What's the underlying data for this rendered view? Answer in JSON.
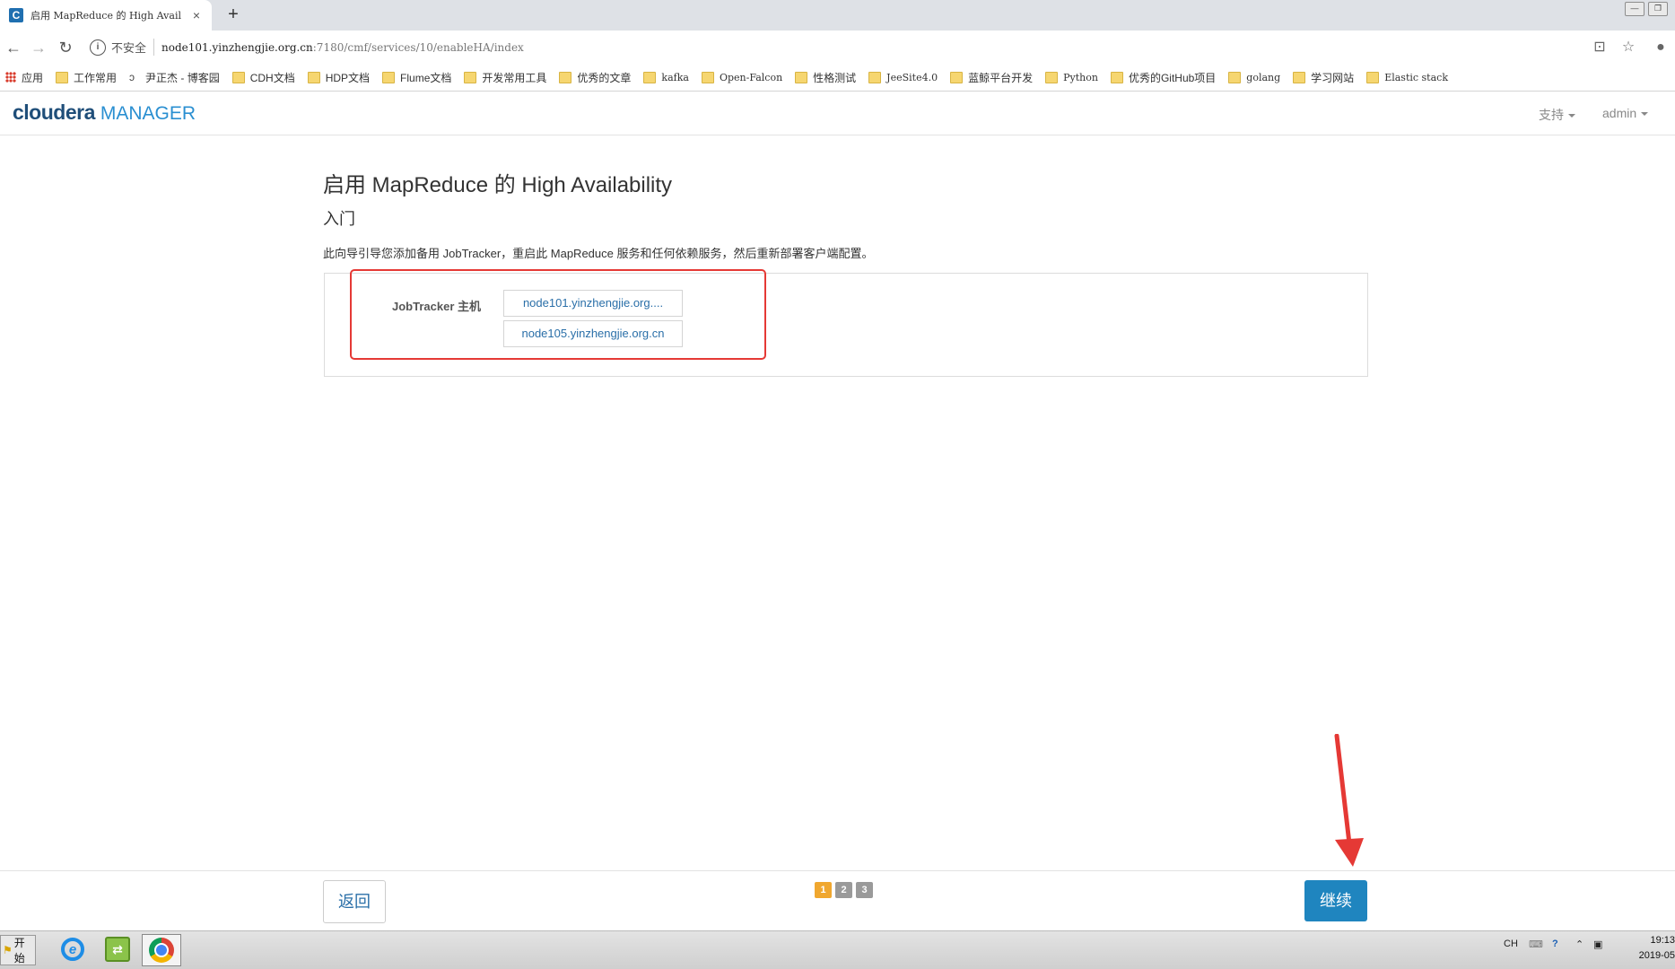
{
  "browser": {
    "tab_title": "启用 MapReduce 的 High Avail",
    "tab_close": "×",
    "favicon_letter": "C",
    "new_tab": "+",
    "security_label": "不安全",
    "url_host": "node101.yinzhengjie.org.cn",
    "url_path": ":7180/cmf/services/10/enableHA/index"
  },
  "bookmarks": [
    {
      "label": "应用",
      "icon": "apps-icon"
    },
    {
      "label": "工作常用",
      "icon": "folder-icon"
    },
    {
      "label": "尹正杰 - 博客园",
      "icon": "web-icon"
    },
    {
      "label": "CDH文档",
      "icon": "folder-icon"
    },
    {
      "label": "HDP文档",
      "icon": "folder-icon"
    },
    {
      "label": "Flume文档",
      "icon": "folder-icon"
    },
    {
      "label": "开发常用工具",
      "icon": "folder-icon"
    },
    {
      "label": "优秀的文章",
      "icon": "folder-icon"
    },
    {
      "label": "kafka",
      "icon": "folder-icon"
    },
    {
      "label": "Open-Falcon",
      "icon": "folder-icon"
    },
    {
      "label": "性格测试",
      "icon": "folder-icon"
    },
    {
      "label": "JeeSite4.0",
      "icon": "folder-icon"
    },
    {
      "label": "蓝鲸平台开发",
      "icon": "folder-icon"
    },
    {
      "label": "Python",
      "icon": "folder-icon"
    },
    {
      "label": "优秀的GitHub项目",
      "icon": "folder-icon"
    },
    {
      "label": "golang",
      "icon": "folder-icon"
    },
    {
      "label": "学习网站",
      "icon": "folder-icon"
    },
    {
      "label": "Elastic stack",
      "icon": "folder-icon"
    }
  ],
  "header": {
    "logo_main": "cloudera",
    "logo_sub": "MANAGER",
    "support_menu": "支持",
    "user_menu": "admin"
  },
  "wizard": {
    "title": "启用 MapReduce 的 High Availability",
    "step_title": "入门",
    "description": "此向导引导您添加备用 JobTracker，重启此 MapReduce 服务和任何依赖服务，然后重新部署客户端配置。",
    "host_label": "JobTracker 主机",
    "hosts": [
      "node101.yinzhengjie.org....",
      "node105.yinzhengjie.org.cn"
    ]
  },
  "footer": {
    "back_label": "返回",
    "continue_label": "继续",
    "pages": [
      "1",
      "2",
      "3"
    ],
    "current_page": 1
  },
  "taskbar": {
    "start_label": "开始",
    "lang": "CH",
    "time": "19:13",
    "date": "2019-05"
  },
  "colors": {
    "primary": "#1f85bf",
    "highlight": "#e53935",
    "pager_active": "#f0a72f"
  }
}
